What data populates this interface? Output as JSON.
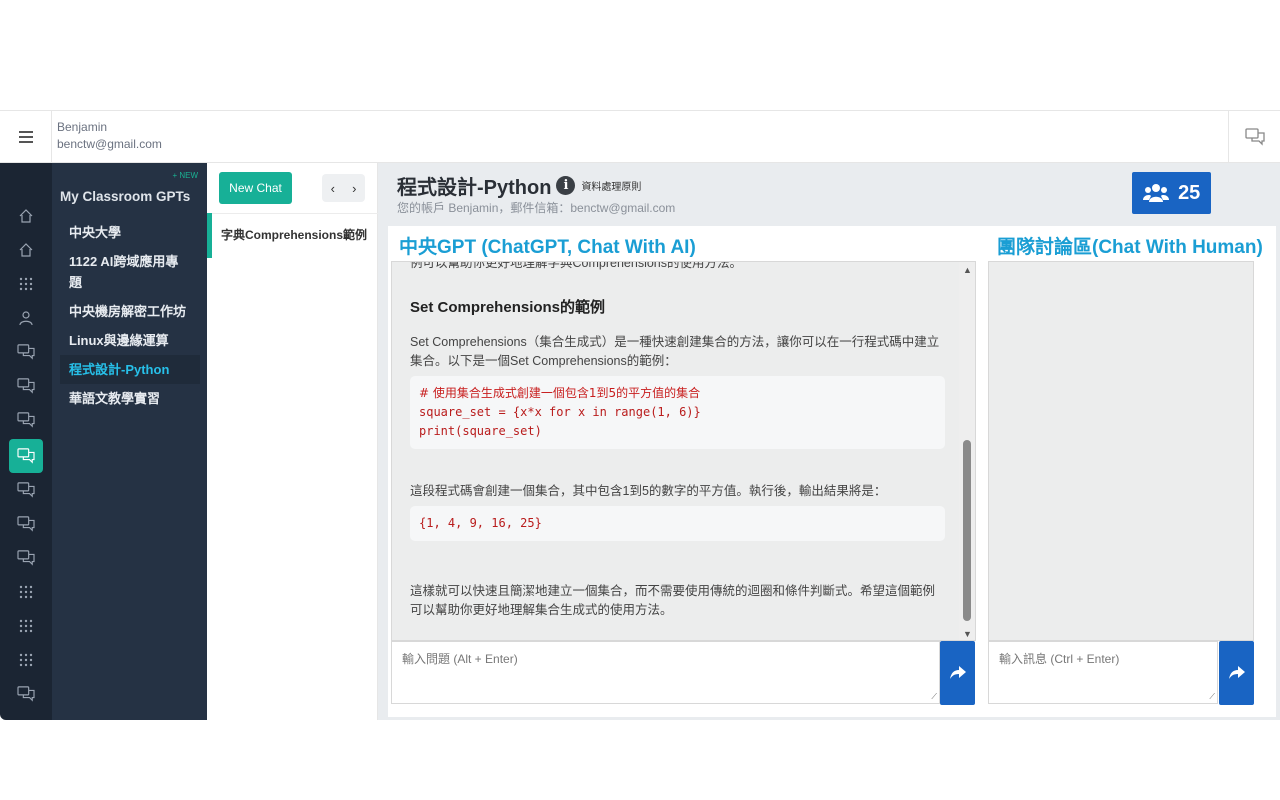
{
  "user": {
    "name": "Benjamin",
    "email": "benctw@gmail.com"
  },
  "classes": {
    "new_tag": "+ NEW",
    "title": "My Classroom GPTs",
    "items": [
      "中央大學",
      "1122 AI跨域應用專題",
      "中央機房解密工作坊",
      "Linux與邊緣運算",
      "程式設計-Python",
      "華語文教學實習"
    ],
    "active_index": 4
  },
  "chatlist": {
    "new_chat_label": "New Chat",
    "prev": "‹",
    "next": "›",
    "items": [
      "字典Comprehensions範例"
    ]
  },
  "header": {
    "course_title": "程式設計-Python",
    "info_icon": "i",
    "privacy_label": "資料處理原則",
    "account_text": "您的帳戶 Benjamin，郵件信箱：benctw@gmail.com",
    "team_count": "25"
  },
  "panels": {
    "ai_title": "中央GPT (ChatGPT, Chat With AI)",
    "team_title": "團隊討論區(Chat With Human)"
  },
  "ai_message": {
    "prev_tail": "例可以幫助你更好地理解字典Comprehensions的使用方法。",
    "heading": "Set Comprehensions的範例",
    "intro": "Set Comprehensions（集合生成式）是一種快速創建集合的方法，讓你可以在一行程式碼中建立集合。以下是一個Set Comprehensions的範例：",
    "code_comment": "# 使用集合生成式創建一個包含1到5的平方值的集合",
    "code_line2": "square_set = {x*x for x in range(1, 6)}",
    "code_line3": "print(square_set)",
    "explain": "這段程式碼會創建一個集合，其中包含1到5的數字的平方值。執行後，輸出結果將是：",
    "output": "{1, 4, 9, 16, 25}",
    "closing": "這樣就可以快速且簡潔地建立一個集合，而不需要使用傳統的迴圈和條件判斷式。希望這個範例可以幫助你更好地理解集合生成式的使用方法。"
  },
  "inputs": {
    "ai_placeholder": "輸入問題 (Alt + Enter)",
    "team_placeholder": "輸入訊息 (Ctrl + Enter)"
  },
  "icons": {
    "menu": "hamburger-icon",
    "chat": "chat-bubbles-icon",
    "team": "users-icon",
    "send": "share-arrow-icon"
  },
  "colors": {
    "accent_green": "#17b097",
    "brand_blue": "#1964c3",
    "heading_blue": "#1a9ed4",
    "sidebar_dark": "#1b2533",
    "sidebar_mid": "#253244"
  }
}
